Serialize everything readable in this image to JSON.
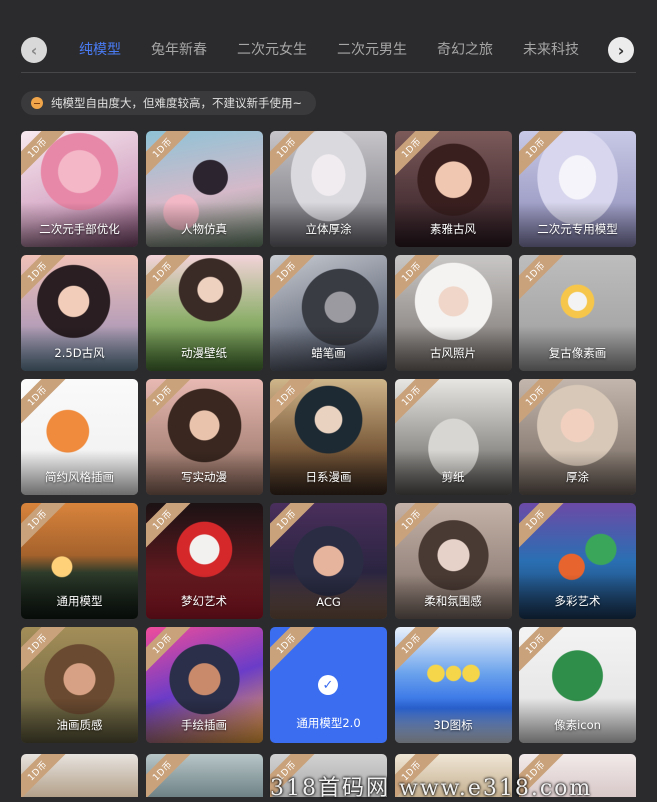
{
  "tabs": [
    "纯模型",
    "兔年新春",
    "二次元女生",
    "二次元男生",
    "奇幻之旅",
    "未来科技"
  ],
  "active_tab": "纯模型",
  "nav": {
    "prev": "‹",
    "next": "›"
  },
  "notice": "纯模型自由度大，但难度较高，不建议新手使用~",
  "badge": "1D币",
  "selected_model": "通用模型2.0",
  "models": [
    "二次元手部优化",
    "人物仿真",
    "立体厚涂",
    "素雅古风",
    "二次元专用模型",
    "2.5D古风",
    "动漫壁纸",
    "蜡笔画",
    "古风照片",
    "复古像素画",
    "简约风格插画",
    "写实动漫",
    "日系漫画",
    "剪纸",
    "厚涂",
    "通用模型",
    "梦幻艺术",
    "ACG",
    "柔和氛围感",
    "多彩艺术",
    "油画质感",
    "手绘插画",
    "通用模型2.0",
    "3D图标",
    "像素icon"
  ],
  "watermark": "318首码网 www.e318.com",
  "colors": {
    "accent": "#4a7cf6",
    "selected_bg": "#3b6df0",
    "badge": "#c9a27c",
    "page_bg": "#2b2b2d"
  }
}
